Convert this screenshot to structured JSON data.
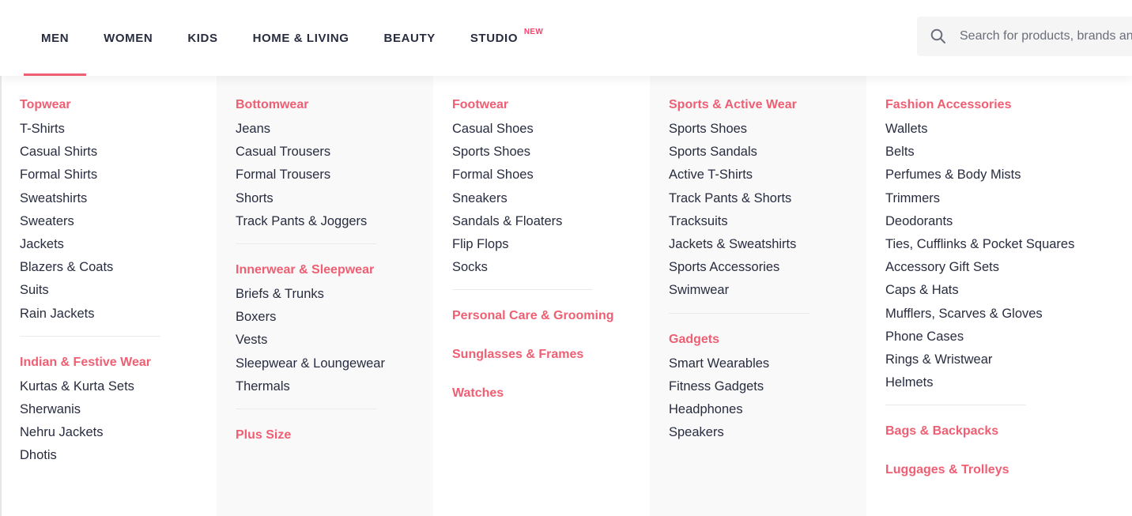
{
  "nav": {
    "items": [
      {
        "label": "MEN"
      },
      {
        "label": "WOMEN"
      },
      {
        "label": "KIDS"
      },
      {
        "label": "HOME & LIVING"
      },
      {
        "label": "BEAUTY"
      },
      {
        "label": "STUDIO"
      }
    ],
    "studio_badge": "NEW"
  },
  "search": {
    "placeholder": "Search for products, brands and more"
  },
  "colors": {
    "accent": "#ee5f73",
    "text": "#282c3f",
    "column_alt_bg": "#f9f9f9"
  },
  "menu": {
    "col1": {
      "topwear": {
        "title": "Topwear",
        "items": [
          "T-Shirts",
          "Casual Shirts",
          "Formal Shirts",
          "Sweatshirts",
          "Sweaters",
          "Jackets",
          "Blazers & Coats",
          "Suits",
          "Rain Jackets"
        ]
      },
      "indian": {
        "title": "Indian & Festive Wear",
        "items": [
          "Kurtas & Kurta Sets",
          "Sherwanis",
          "Nehru Jackets",
          "Dhotis"
        ]
      }
    },
    "col2": {
      "bottomwear": {
        "title": "Bottomwear",
        "items": [
          "Jeans",
          "Casual Trousers",
          "Formal Trousers",
          "Shorts",
          "Track Pants & Joggers"
        ]
      },
      "innerwear": {
        "title": "Innerwear & Sleepwear",
        "items": [
          "Briefs & Trunks",
          "Boxers",
          "Vests",
          "Sleepwear & Loungewear",
          "Thermals"
        ]
      },
      "plus_size": {
        "title": "Plus Size"
      }
    },
    "col3": {
      "footwear": {
        "title": "Footwear",
        "items": [
          "Casual Shoes",
          "Sports Shoes",
          "Formal Shoes",
          "Sneakers",
          "Sandals & Floaters",
          "Flip Flops",
          "Socks"
        ]
      },
      "personal_care": {
        "title": "Personal Care & Grooming"
      },
      "sunglasses": {
        "title": "Sunglasses & Frames"
      },
      "watches": {
        "title": "Watches"
      }
    },
    "col4": {
      "sports": {
        "title": "Sports & Active Wear",
        "items": [
          "Sports Shoes",
          "Sports Sandals",
          "Active T-Shirts",
          "Track Pants & Shorts",
          "Tracksuits",
          "Jackets & Sweatshirts",
          "Sports Accessories",
          "Swimwear"
        ]
      },
      "gadgets": {
        "title": "Gadgets",
        "items": [
          "Smart Wearables",
          "Fitness Gadgets",
          "Headphones",
          "Speakers"
        ]
      }
    },
    "col5": {
      "fashion_acc": {
        "title": "Fashion Accessories",
        "items": [
          "Wallets",
          "Belts",
          "Perfumes & Body Mists",
          "Trimmers",
          "Deodorants",
          "Ties, Cufflinks & Pocket Squares",
          "Accessory Gift Sets",
          "Caps & Hats",
          "Mufflers, Scarves & Gloves",
          "Phone Cases",
          "Rings & Wristwear",
          "Helmets"
        ]
      },
      "bags": {
        "title": "Bags & Backpacks"
      },
      "luggage": {
        "title": "Luggages & Trolleys"
      }
    }
  }
}
